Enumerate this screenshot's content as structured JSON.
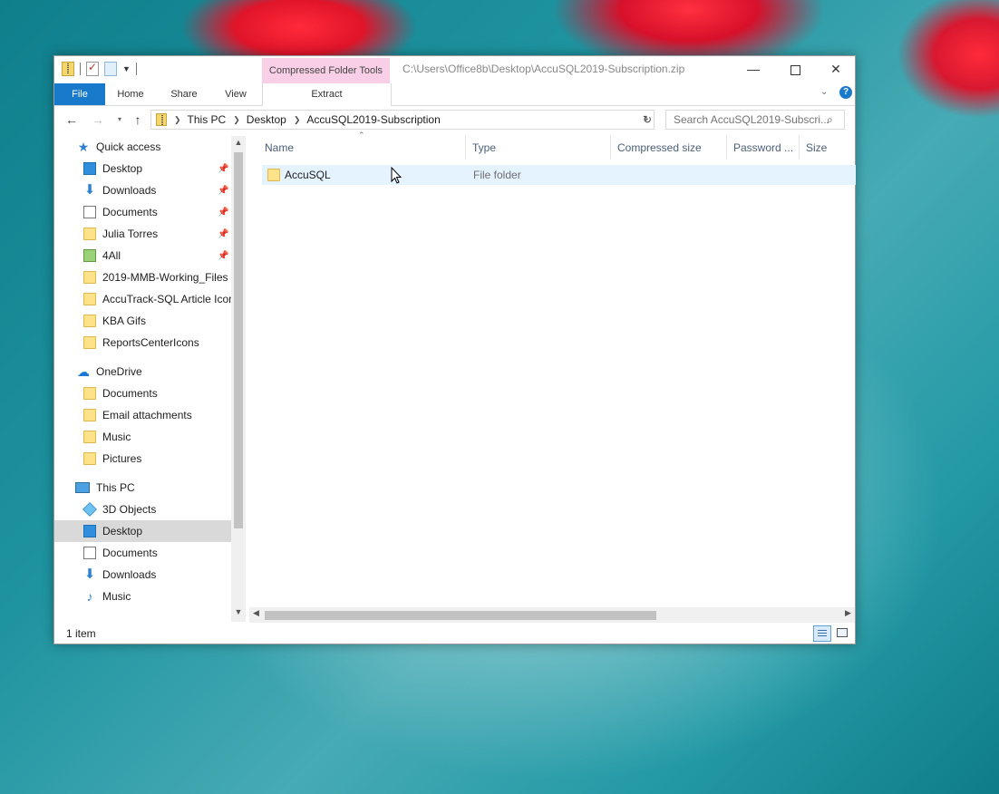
{
  "window": {
    "context_tab": "Compressed Folder Tools",
    "title_path": "C:\\Users\\Office8b\\Desktop\\AccuSQL2019-Subscription.zip"
  },
  "ribbon": {
    "tabs": [
      "File",
      "Home",
      "Share",
      "View",
      "Extract"
    ],
    "help_label": "?"
  },
  "address": {
    "crumbs": [
      "This PC",
      "Desktop",
      "AccuSQL2019-Subscription"
    ],
    "search_placeholder": "Search AccuSQL2019-Subscri..."
  },
  "nav_pane": {
    "quick_access": {
      "label": "Quick access",
      "items": [
        {
          "label": "Desktop",
          "pinned": true
        },
        {
          "label": "Downloads",
          "pinned": true
        },
        {
          "label": "Documents",
          "pinned": true
        },
        {
          "label": "Julia Torres",
          "pinned": true
        },
        {
          "label": "4All",
          "pinned": true
        },
        {
          "label": "2019-MMB-Working_Files",
          "pinned": false
        },
        {
          "label": "AccuTrack-SQL Article Icon",
          "pinned": false
        },
        {
          "label": "KBA Gifs",
          "pinned": false
        },
        {
          "label": "ReportsCenterIcons",
          "pinned": false
        }
      ]
    },
    "onedrive": {
      "label": "OneDrive",
      "items": [
        "Documents",
        "Email attachments",
        "Music",
        "Pictures"
      ]
    },
    "this_pc": {
      "label": "This PC",
      "items": [
        "3D Objects",
        "Desktop",
        "Documents",
        "Downloads",
        "Music"
      ],
      "selected": "Desktop"
    }
  },
  "columns": [
    "Name",
    "Type",
    "Compressed size",
    "Password ...",
    "Size"
  ],
  "files": [
    {
      "name": "AccuSQL",
      "type": "File folder",
      "compressed_size": "",
      "password": "",
      "size": ""
    }
  ],
  "status": {
    "item_count": "1 item"
  }
}
